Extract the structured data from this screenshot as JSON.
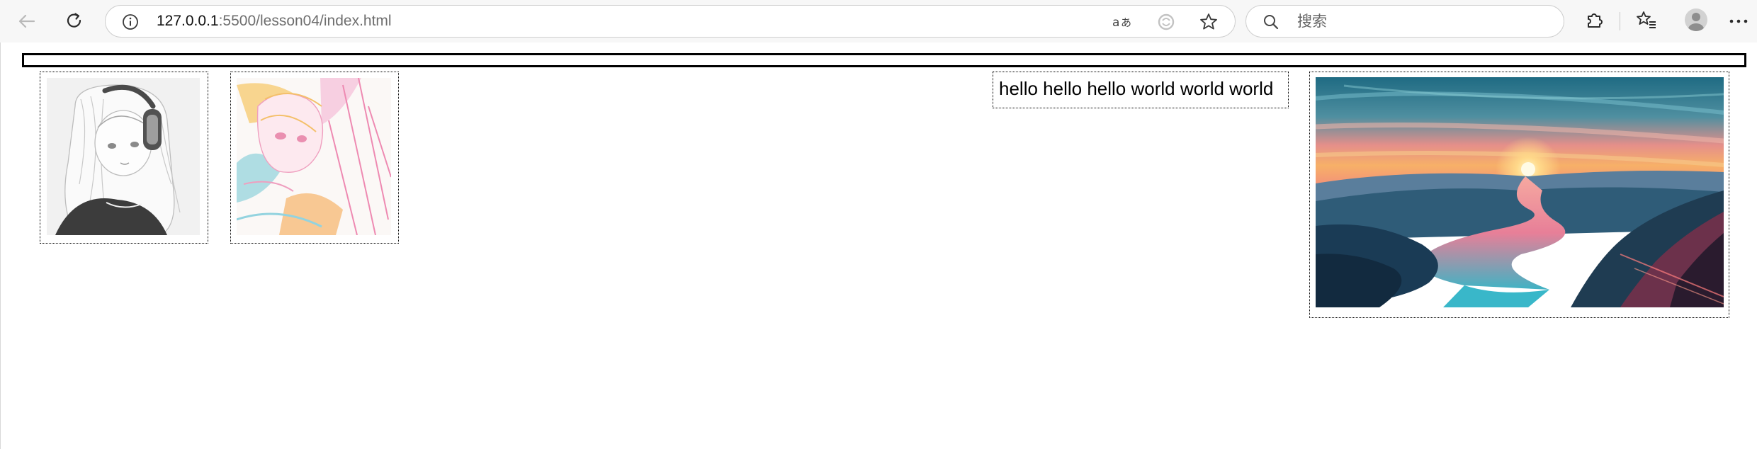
{
  "browser": {
    "address": {
      "host": "127.0.0.1",
      "path": ":5500/lesson04/index.html"
    },
    "search": {
      "placeholder": "搜索"
    },
    "icons": {
      "back": "arrow-left-icon",
      "refresh": "refresh-icon",
      "site_info": "info-circle-icon",
      "read_aloud": "read-aloud-icon",
      "translate": "translate-icon",
      "favorite": "star-icon",
      "search": "search-icon",
      "extensions": "puzzle-icon",
      "favorites_list": "favorites-list-icon",
      "profile": "avatar-icon",
      "menu": "more-horizontal-icon"
    }
  },
  "page": {
    "text_box": "hello hello hello world world world",
    "images": [
      {
        "name": "anime-girl-headphones-sketch",
        "subject": "grayscale anime girl with headphones"
      },
      {
        "name": "anime-girl-pastel-sketch",
        "subject": "pastel colored anime girl sketch"
      },
      {
        "name": "sunset-landscape-painting",
        "subject": "sunset over a river valley"
      }
    ]
  },
  "colors": {
    "toolbar_bg": "#f7f7f7",
    "border": "#000000",
    "sunset_orange": "#f5a361",
    "river_teal": "#3fb3c4",
    "sky_teal": "#2e6a84"
  }
}
